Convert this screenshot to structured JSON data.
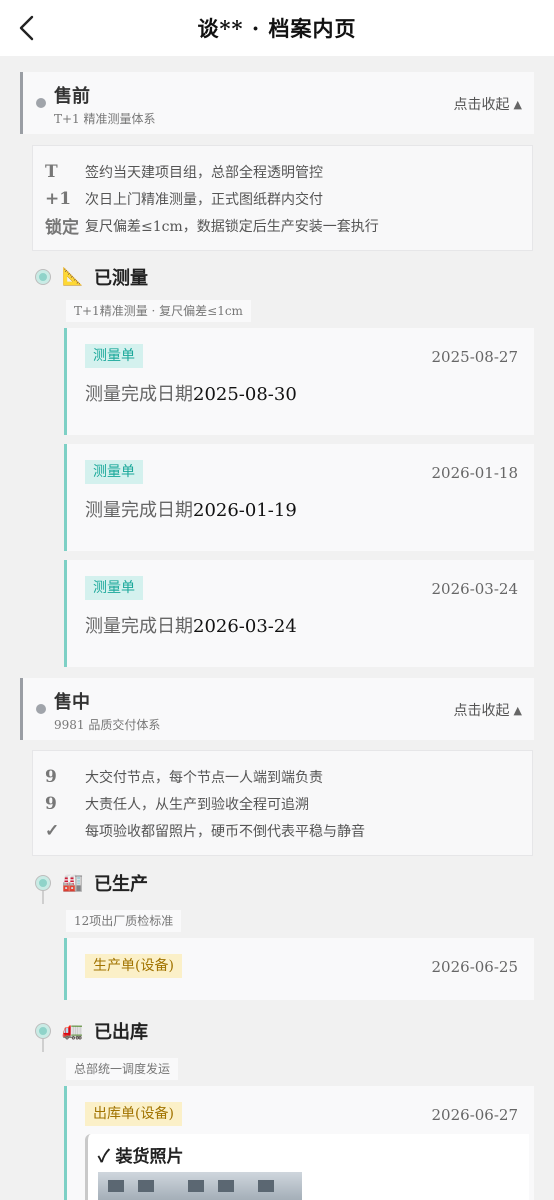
{
  "header": {
    "title": "谈** · 档案内页"
  },
  "sections": [
    {
      "title": "售前",
      "subtitle": "T+1 精准测量体系",
      "collapse_label": "点击收起",
      "info": [
        {
          "key": "T",
          "text": "签约当天建项目组，总部全程透明管控"
        },
        {
          "key": "+1",
          "text": "次日上门精准测量，正式图纸群内交付"
        },
        {
          "key": "锁定",
          "text": "复尺偏差≤1cm，数据锁定后生产安装一套执行"
        }
      ],
      "stages": [
        {
          "title": "已测量",
          "chip": "T+1精准测量 · 复尺偏差≤1cm",
          "records": [
            {
              "badge": "测量单",
              "date": "2025-08-27",
              "label": "测量完成日期",
              "value": "2025-08-30"
            },
            {
              "badge": "测量单",
              "date": "2026-01-18",
              "label": "测量完成日期",
              "value": "2026-01-19"
            },
            {
              "badge": "测量单",
              "date": "2026-03-24",
              "label": "测量完成日期",
              "value": "2026-03-24"
            }
          ]
        }
      ]
    },
    {
      "title": "售中",
      "subtitle": "9981 品质交付体系",
      "collapse_label": "点击收起",
      "info": [
        {
          "key": "9",
          "text": "大交付节点，每个节点一人端到端负责"
        },
        {
          "key": "9",
          "text": "大责任人，从生产到验收全程可追溯"
        },
        {
          "key": "✓",
          "text": "每项验收都留照片，硬币不倒代表平稳与静音"
        }
      ],
      "stages": [
        {
          "title": "已生产",
          "chip": "12项出厂质检标准",
          "records": [
            {
              "badge": "生产单(设备)",
              "date": "2026-06-25"
            }
          ]
        },
        {
          "title": "已出库",
          "chip": "总部统一调度发运",
          "records": [
            {
              "badge": "出库单(设备)",
              "date": "2026-06-27",
              "photo_title": "✓ 装货照片"
            }
          ]
        }
      ]
    }
  ],
  "colors": {
    "accent": "#7dd0c5",
    "badge_teal_bg": "#d4f1ee",
    "badge_yellow_bg": "#fbf0c8"
  },
  "icons": {
    "measure": "triangle-ruler-icon",
    "produce": "factory-icon",
    "ship": "truck-icon"
  }
}
